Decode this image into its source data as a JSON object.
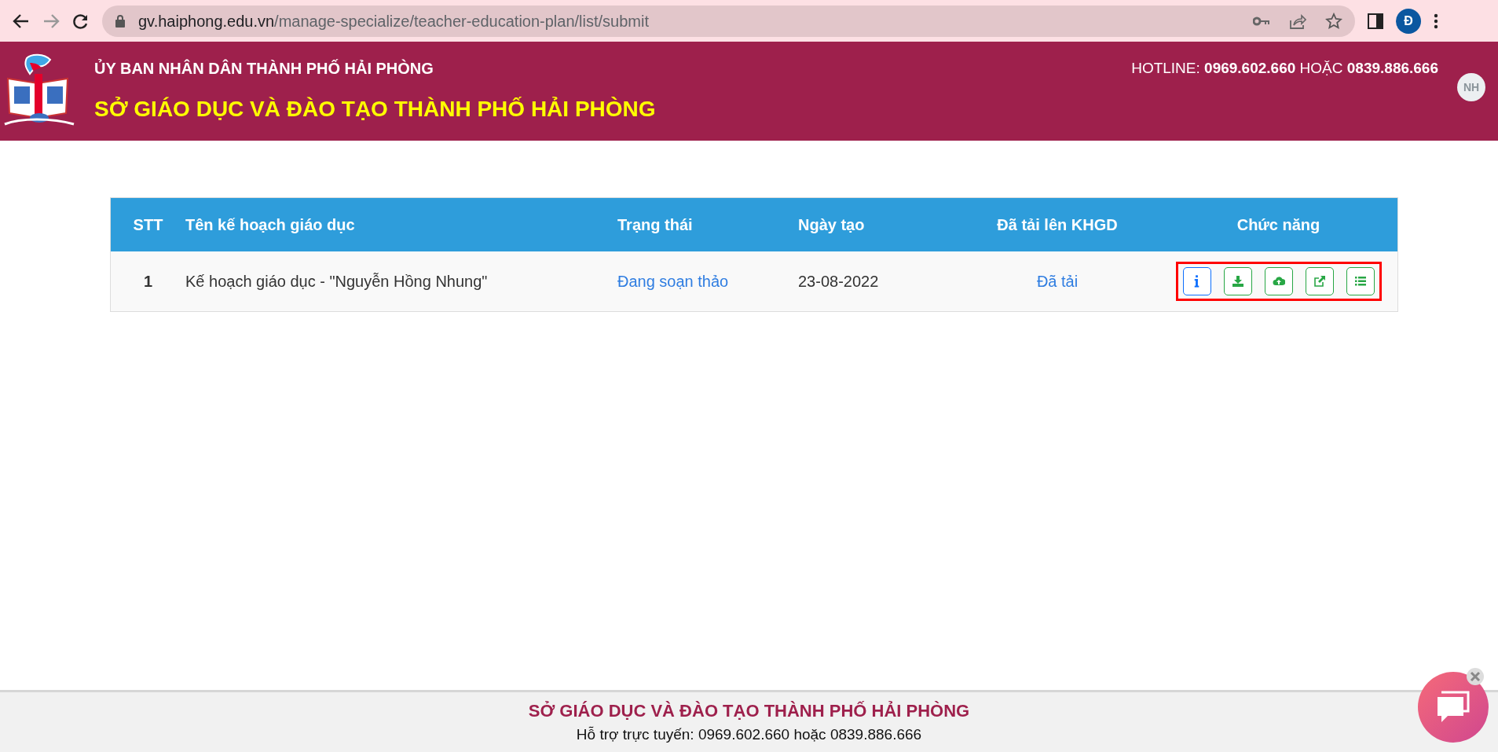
{
  "browser": {
    "url_host": "gv.haiphong.edu.vn",
    "url_path": "/manage-specialize/teacher-education-plan/list/submit",
    "profile_initial": "Đ"
  },
  "header": {
    "org_line": "ỦY BAN NHÂN DÂN THÀNH PHỐ HẢI PHÒNG",
    "title": "SỞ GIÁO DỤC VÀ ĐÀO TẠO THÀNH PHỐ HẢI PHÒNG",
    "hotline": "HOTLINE: **0969.602.660** HOẶC **0839.886.666**",
    "user_initials": "NH"
  },
  "table": {
    "columns": [
      "STT",
      "Tên kế hoạch giáo dục",
      "Trạng thái",
      "Ngày tạo",
      "Đã tải lên KHGD",
      "Chức năng"
    ],
    "rows": [
      {
        "stt": "1",
        "name": "Kế hoạch giáo dục - \"Nguyễn Hồng Nhung\"",
        "status": "Đang soạn thảo",
        "created": "23-08-2022",
        "uploaded": "Đã tải",
        "actions": [
          {
            "kind": "info",
            "color": "#0d6efd"
          },
          {
            "kind": "download",
            "color": "#28a745"
          },
          {
            "kind": "upload",
            "color": "#28a745"
          },
          {
            "kind": "external",
            "color": "#28a745"
          },
          {
            "kind": "list",
            "color": "#28a745"
          }
        ],
        "actions_highlighted": true
      }
    ]
  },
  "footer": {
    "title": "SỞ GIÁO DỤC VÀ ĐÀO TẠO THÀNH PHỐ HẢI PHÒNG",
    "support": "Hỗ trợ trực tuyến: 0969.602.660 hoặc 0839.886.666"
  }
}
